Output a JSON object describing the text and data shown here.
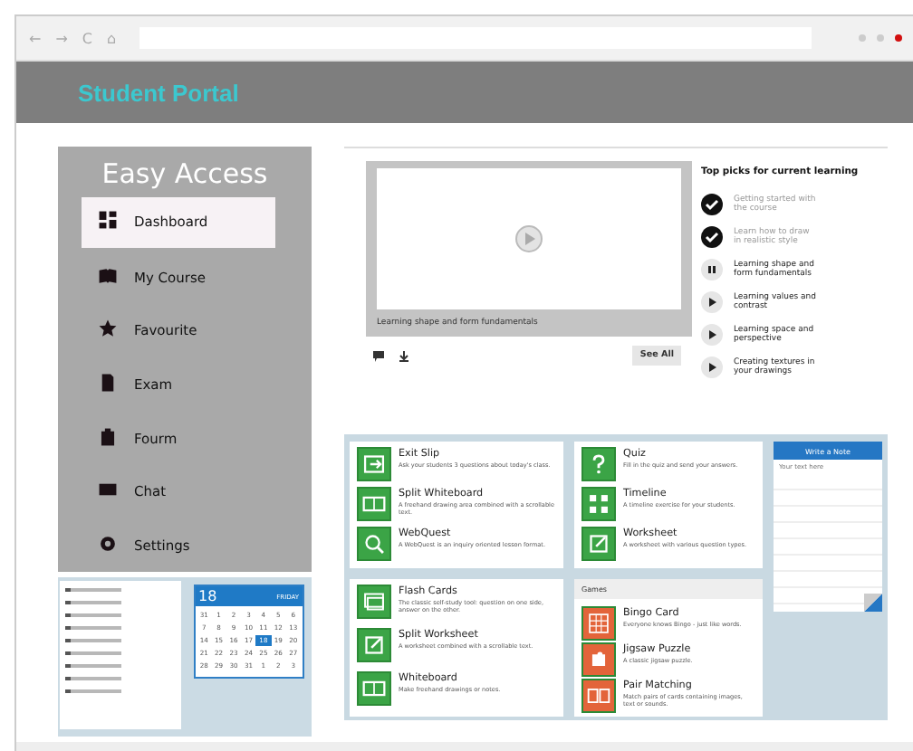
{
  "browser": {
    "nav": [
      "←",
      "→",
      "C",
      "⌂"
    ]
  },
  "header": {
    "title": "Student Portal"
  },
  "sidebar": {
    "title": "Easy Access",
    "items": [
      {
        "label": "Dashboard",
        "selected": true
      },
      {
        "label": "My Course",
        "selected": false
      },
      {
        "label": "Favourite",
        "selected": false
      },
      {
        "label": "Exam",
        "selected": false
      },
      {
        "label": "Fourm",
        "selected": false
      },
      {
        "label": "Chat",
        "selected": false
      },
      {
        "label": "Settings",
        "selected": false
      }
    ]
  },
  "calendar": {
    "day": "18",
    "weekday": "FRIDAY",
    "dates": [
      {
        "label": "31",
        "selected": false
      },
      {
        "label": "1",
        "selected": false
      },
      {
        "label": "2",
        "selected": false
      },
      {
        "label": "3",
        "selected": false
      },
      {
        "label": "4",
        "selected": false
      },
      {
        "label": "5",
        "selected": false
      },
      {
        "label": "6",
        "selected": false
      },
      {
        "label": "7",
        "selected": false
      },
      {
        "label": "8",
        "selected": false
      },
      {
        "label": "9",
        "selected": false
      },
      {
        "label": "10",
        "selected": false
      },
      {
        "label": "11",
        "selected": false
      },
      {
        "label": "12",
        "selected": false
      },
      {
        "label": "13",
        "selected": false
      },
      {
        "label": "14",
        "selected": false
      },
      {
        "label": "15",
        "selected": false
      },
      {
        "label": "16",
        "selected": false
      },
      {
        "label": "17",
        "selected": false
      },
      {
        "label": "18",
        "selected": true
      },
      {
        "label": "19",
        "selected": false
      },
      {
        "label": "20",
        "selected": false
      },
      {
        "label": "21",
        "selected": false
      },
      {
        "label": "22",
        "selected": false
      },
      {
        "label": "23",
        "selected": false
      },
      {
        "label": "24",
        "selected": false
      },
      {
        "label": "25",
        "selected": false
      },
      {
        "label": "26",
        "selected": false
      },
      {
        "label": "27",
        "selected": false
      },
      {
        "label": "28",
        "selected": false
      },
      {
        "label": "29",
        "selected": false
      },
      {
        "label": "30",
        "selected": false
      },
      {
        "label": "31",
        "selected": false
      },
      {
        "label": "1",
        "selected": false
      },
      {
        "label": "2",
        "selected": false
      },
      {
        "label": "3",
        "selected": false
      }
    ]
  },
  "video": {
    "caption": "Learning shape and form fundamentals",
    "see_all": "See All"
  },
  "top_picks": {
    "title": "Top picks for current learning",
    "items": [
      {
        "label": "Getting started with the course",
        "kind": "done"
      },
      {
        "label": "Learn how to draw in realistic style",
        "kind": "done"
      },
      {
        "label": "Learning shape and form fundamentals",
        "kind": "current"
      },
      {
        "label": "Learning values and contrast",
        "kind": "pending"
      },
      {
        "label": "Learning space and perspective",
        "kind": "pending"
      },
      {
        "label": "Creating textures in your drawings",
        "kind": "pending"
      }
    ]
  },
  "activities": [
    {
      "items": [
        {
          "title": "Exit Slip",
          "text": "Ask your students 3 questions about today's class."
        },
        {
          "title": "Split Whiteboard",
          "text": "A freehand drawing area combined with a scrollable text."
        },
        {
          "title": "WebQuest",
          "text": "A WebQuest is an inquiry oriented lesson format."
        }
      ]
    },
    {
      "items": [
        {
          "title": "Flash Cards",
          "text": "The classic self-study tool: question on one side, answer on the other."
        },
        {
          "title": "Split Worksheet",
          "text": "A worksheet combined with a scrollable text."
        },
        {
          "title": "Whiteboard",
          "text": "Make freehand drawings or notes."
        }
      ]
    },
    {
      "items": [
        {
          "title": "Quiz",
          "text": "Fill in the quiz and send your answers."
        },
        {
          "title": "Timeline",
          "text": "A timeline exercise for your students."
        },
        {
          "title": "Worksheet",
          "text": "A worksheet with various question types."
        }
      ]
    }
  ],
  "games": {
    "title": "Games",
    "items": [
      {
        "title": "Bingo Card",
        "text": "Everyone knows Bingo - just like words."
      },
      {
        "title": "Jigsaw Puzzle",
        "text": "A classic jigsaw puzzle."
      },
      {
        "title": "Pair Matching",
        "text": "Match pairs of cards containing images, text or sounds."
      }
    ]
  },
  "note": {
    "title": "Write a Note",
    "placeholder": "Your text here"
  }
}
